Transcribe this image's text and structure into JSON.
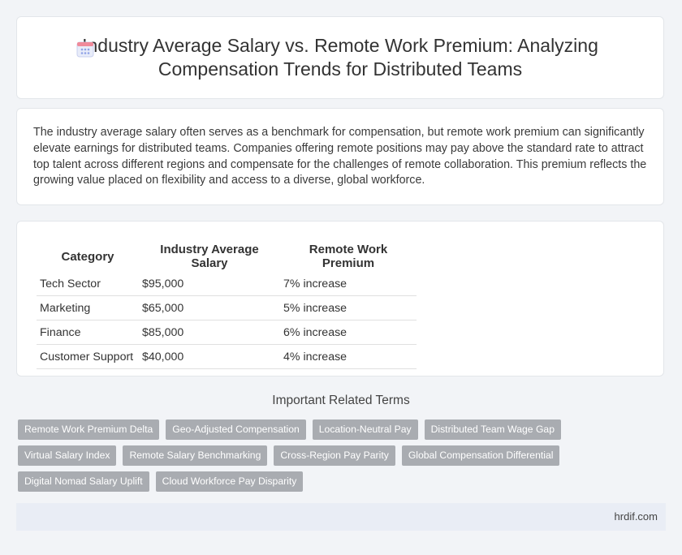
{
  "header": {
    "title": "Industry Average Salary vs. Remote Work Premium: Analyzing Compensation Trends for Distributed Teams",
    "icon": "calendar-icon"
  },
  "intro": {
    "text": "The industry average salary often serves as a benchmark for compensation, but remote work premium can significantly elevate earnings for distributed teams. Companies offering remote positions may pay above the standard rate to attract top talent across different regions and compensate for the challenges of remote collaboration. This premium reflects the growing value placed on flexibility and access to a diverse, global workforce."
  },
  "table": {
    "headers": [
      "Category",
      "Industry Average Salary",
      "Remote Work Premium"
    ],
    "rows": [
      [
        "Tech Sector",
        "$95,000",
        "7% increase"
      ],
      [
        "Marketing",
        "$65,000",
        "5% increase"
      ],
      [
        "Finance",
        "$85,000",
        "6% increase"
      ],
      [
        "Customer Support",
        "$40,000",
        "4% increase"
      ]
    ]
  },
  "related": {
    "heading": "Important Related Terms",
    "tags": [
      "Remote Work Premium Delta",
      "Geo-Adjusted Compensation",
      "Location-Neutral Pay",
      "Distributed Team Wage Gap",
      "Virtual Salary Index",
      "Remote Salary Benchmarking",
      "Cross-Region Pay Parity",
      "Global Compensation Differential",
      "Digital Nomad Salary Uplift",
      "Cloud Workforce Pay Disparity"
    ]
  },
  "footer": {
    "site": "hrdif.com"
  },
  "colors": {
    "tag_bg": "#a9acb1",
    "footer_bg": "#e9edf5",
    "page_bg": "#f2f4f7"
  }
}
